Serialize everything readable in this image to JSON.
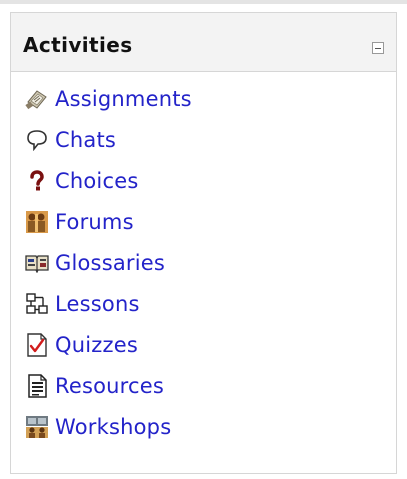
{
  "block": {
    "title": "Activities",
    "collapse_icon": "minus-box-icon",
    "items": [
      {
        "label": "Assignments",
        "icon": "assignment-icon"
      },
      {
        "label": "Chats",
        "icon": "chat-bubble-icon"
      },
      {
        "label": "Choices",
        "icon": "question-mark-icon"
      },
      {
        "label": "Forums",
        "icon": "forum-people-icon"
      },
      {
        "label": "Glossaries",
        "icon": "glossary-book-icon"
      },
      {
        "label": "Lessons",
        "icon": "lesson-flowchart-icon"
      },
      {
        "label": "Quizzes",
        "icon": "quiz-checkmark-icon"
      },
      {
        "label": "Resources",
        "icon": "resource-document-icon"
      },
      {
        "label": "Workshops",
        "icon": "workshop-people-icon"
      }
    ]
  },
  "colors": {
    "link": "#2323c9",
    "header_bg": "#f3f3f3",
    "border": "#d6d6d6"
  }
}
